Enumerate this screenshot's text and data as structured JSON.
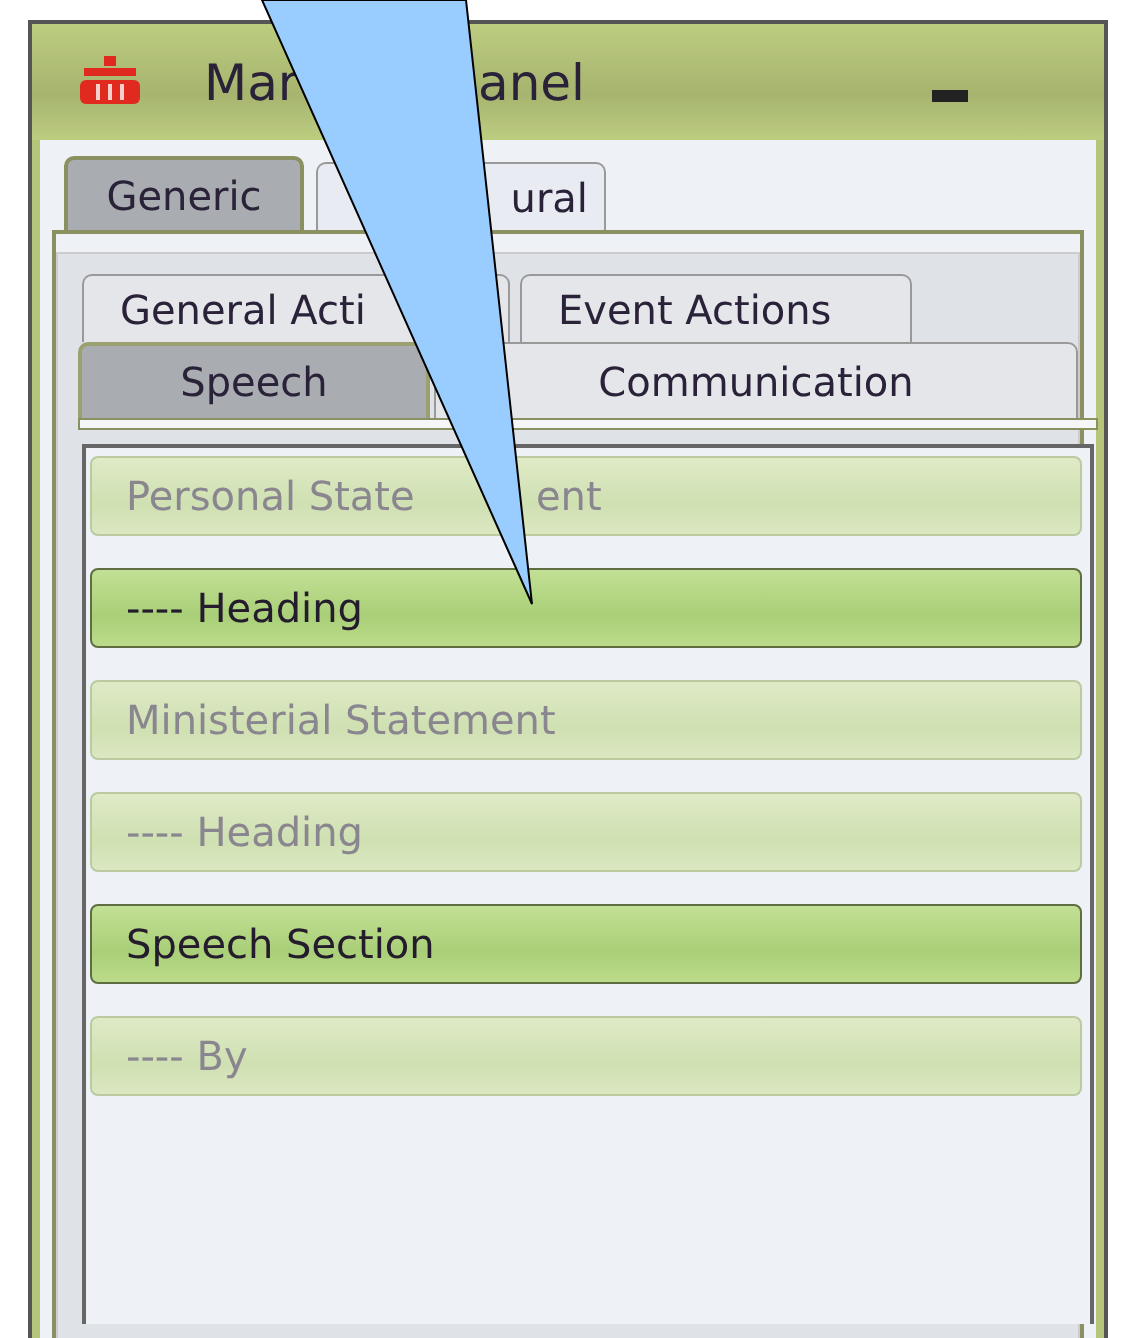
{
  "window": {
    "title": "Mar",
    "title_after": "anel"
  },
  "tabs": [
    {
      "label": "Generic",
      "selected": true
    },
    {
      "label": "ural",
      "selected": false
    }
  ],
  "subtabs_back": [
    {
      "label": "General Acti",
      "selected": false
    },
    {
      "label": "Event Actions",
      "selected": false
    }
  ],
  "subtabs_front": [
    {
      "label": "Speech",
      "selected": true
    },
    {
      "label": "Communication",
      "selected": false
    }
  ],
  "items": [
    {
      "label": "Personal State",
      "label_after": "ent",
      "active": false
    },
    {
      "label": "---- Heading",
      "active": true
    },
    {
      "label": "Ministerial Statement",
      "active": false
    },
    {
      "label": "---- Heading",
      "active": false
    },
    {
      "label": "Speech Section",
      "active": true
    },
    {
      "label": "---- By",
      "active": false
    }
  ]
}
